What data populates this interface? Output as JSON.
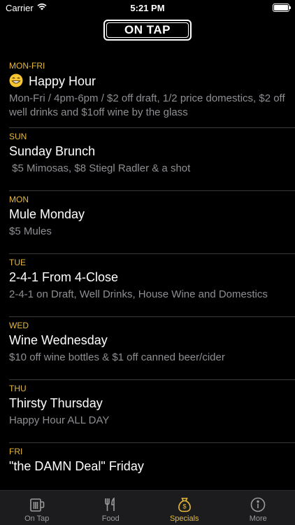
{
  "status_bar": {
    "carrier": "Carrier",
    "time": "5:21 PM"
  },
  "header": {
    "logo_text": "ON TAP"
  },
  "colors": {
    "accent": "#e7b93a",
    "background": "#000000",
    "secondary_text": "#8e8e93"
  },
  "specials": [
    {
      "day": "MON-FRI",
      "icon": "grinning-face-emoji",
      "title": "Happy Hour",
      "description": "Mon-Fri / 4pm-6pm / $2 off draft, 1/2 price domestics, $2 off well drinks and $1off wine by the glass"
    },
    {
      "day": "SUN",
      "title": "Sunday Brunch",
      "description": " $5 Mimosas, $8 Stiegl Radler & a shot"
    },
    {
      "day": "MON",
      "title": "Mule Monday",
      "description": "$5 Mules"
    },
    {
      "day": "TUE",
      "title": "2-4-1 From 4-Close",
      "description": "2-4-1 on Draft, Well Drinks, House Wine and Domestics"
    },
    {
      "day": "WED",
      "title": "Wine Wednesday",
      "description": "$10 off wine bottles & $1 off canned beer/cider"
    },
    {
      "day": "THU",
      "title": "Thirsty Thursday",
      "description": "Happy Hour ALL DAY"
    },
    {
      "day": "FRI",
      "title": "\"the DAMN Deal\" Friday",
      "description": ""
    }
  ],
  "tabbar": {
    "tabs": [
      {
        "label": "On Tap",
        "icon": "beer-mug-icon",
        "active": false
      },
      {
        "label": "Food",
        "icon": "fork-knife-icon",
        "active": false
      },
      {
        "label": "Specials",
        "icon": "money-bag-icon",
        "active": true
      },
      {
        "label": "More",
        "icon": "info-icon",
        "active": false
      }
    ]
  }
}
